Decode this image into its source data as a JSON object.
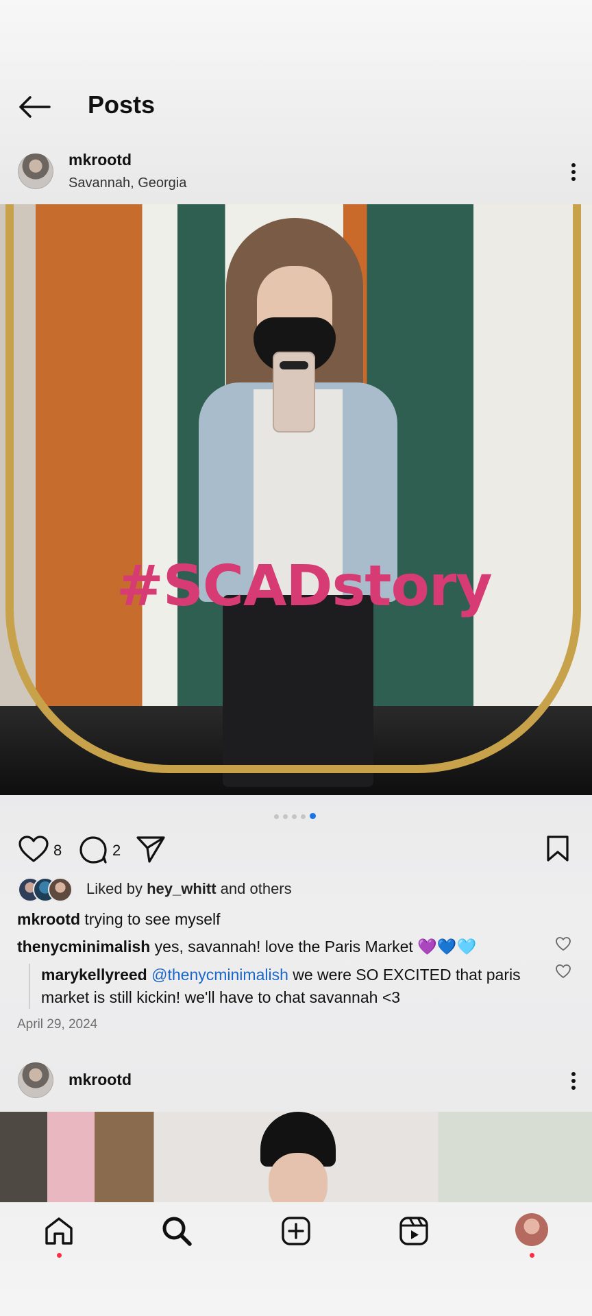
{
  "header": {
    "title": "Posts"
  },
  "post1": {
    "username": "mkrootd",
    "location": "Savannah, Georgia",
    "overlay_text": "#SCADstory",
    "carousel": {
      "count": 5,
      "active": 5
    },
    "likes_count": "8",
    "comments_count": "2",
    "liked_by": {
      "prefix": "Liked by",
      "user": "hey_whitt",
      "suffix": "and others"
    },
    "caption": {
      "user": "mkrootd",
      "text": "trying to see myself"
    },
    "comments": [
      {
        "user": "thenycminimalish",
        "text": "yes, savannah! love the Paris Market 💜💙🩵"
      }
    ],
    "reply": {
      "user": "marykellyreed",
      "mention": "@thenycminimalish",
      "text": "we were SO EXCITED that paris market is still kickin! we'll have to chat savannah <3"
    },
    "date": "April 29, 2024"
  },
  "post2": {
    "username": "mkrootd"
  },
  "nav": {
    "items": [
      "home-icon",
      "search-icon",
      "create-icon",
      "reels-icon",
      "profile-avatar"
    ]
  },
  "colors": {
    "accent": "#1b74e4",
    "link": "#1b66c9",
    "notification": "#ff2b45",
    "overlay_text": "#d63b74"
  }
}
